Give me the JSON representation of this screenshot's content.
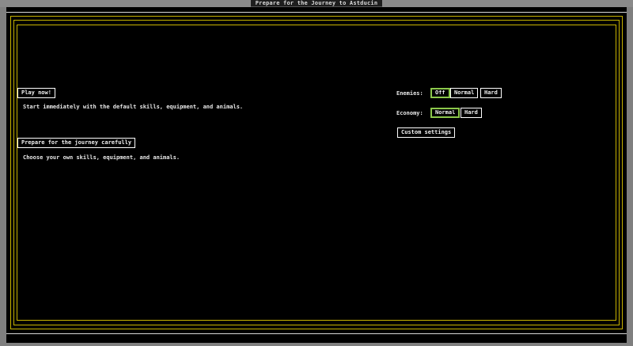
{
  "window": {
    "title": "Prepare for the Journey to Astducin"
  },
  "colors": {
    "background": "#000000",
    "frame": "#c8b400",
    "text": "#e8e8e8",
    "selected_border": "#8cc84b"
  },
  "left_panel": {
    "play_now": {
      "label": "Play now!",
      "description": "Start immediately with the default skills, equipment, and animals."
    },
    "prepare": {
      "label": "Prepare for the journey carefully",
      "description": "Choose your own skills, equipment, and animals."
    }
  },
  "right_panel": {
    "enemies": {
      "label": "Enemies:",
      "options": [
        "Off",
        "Normal",
        "Hard"
      ],
      "selected": "Off"
    },
    "economy": {
      "label": "Economy:",
      "options": [
        "Normal",
        "Hard"
      ],
      "selected": "Normal"
    },
    "custom_settings": {
      "label": "Custom settings"
    }
  }
}
